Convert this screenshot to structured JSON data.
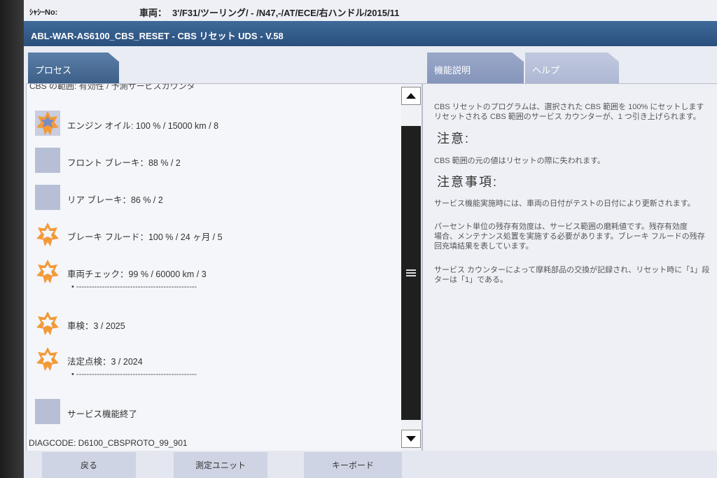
{
  "vehicle_bar": {
    "chassis_label": "ｼｬｼｰNo:",
    "vehicle_label": "車両：",
    "vehicle_value": "3'/F31/ツーリング/ - /N47,-/AT/ECE/右ハンドル/2015/11"
  },
  "job_title": "ABL-WAR-AS6100_CBS_RESET - CBS リセット UDS - V.58",
  "tabs": {
    "process": "プロセス",
    "function_description": "機能説明",
    "help": "ヘルプ"
  },
  "left_panel": {
    "partial_header": "CBS の範囲: 有効性 / 予測サービスカウンタ",
    "items": [
      {
        "label": "エンジン オイル: 100 % / 15000 km / 8",
        "icon": "star-icon"
      },
      {
        "label": "フロント ブレーキ：88 % / 2",
        "icon": "square-icon"
      },
      {
        "label": "リア ブレーキ：86 % / 2",
        "icon": "square-icon"
      },
      {
        "label": "ブレーキ フルード：100 % / 24 ヶ月 / 5",
        "icon": "star-icon"
      },
      {
        "label": "車両チェック：99 % / 60000 km / 3",
        "icon": "star-icon",
        "sub": "• -----------------------------------------------"
      },
      {
        "label": "車検：3 / 2025",
        "icon": "star-icon"
      },
      {
        "label": "法定点検：3 / 2024",
        "icon": "star-icon",
        "sub": "• -----------------------------------------------"
      },
      {
        "label": "サービス機能終了",
        "icon": "square-icon"
      }
    ],
    "diagcode": "DIAGCODE: D6100_CBSPROTO_99_901"
  },
  "right_panel": {
    "intro_line1": "CBS リセットのプログラムは、選択された CBS 範囲を 100% にセットします",
    "intro_line2": "リセットされる CBS 範囲のサービス カウンターが、1 つ引き上げられます。",
    "heading_caution": "注意:",
    "caution_text": "CBS 範囲の元の値はリセットの際に失われます。",
    "heading_notes": "注意事項:",
    "note1": "サービス機能実施時には、車両の日付がテストの日付により更新されます。",
    "note2_line1": "パーセント単位の残存有効度は、サービス範囲の磨耗値です。残存有効度",
    "note2_line2": "場合、メンテナンス処置を実施する必要があります。ブレーキ フルードの残存",
    "note2_line3": "回充填結果を表しています。",
    "note3_line1": "サービス カウンターによって摩耗部品の交換が記録され、リセット時に「1」段",
    "note3_line2": "ターは「1」である。"
  },
  "bottom_bar": {
    "back": "戻る",
    "measure_unit": "測定ユニット",
    "keyboard": "キーボード"
  }
}
